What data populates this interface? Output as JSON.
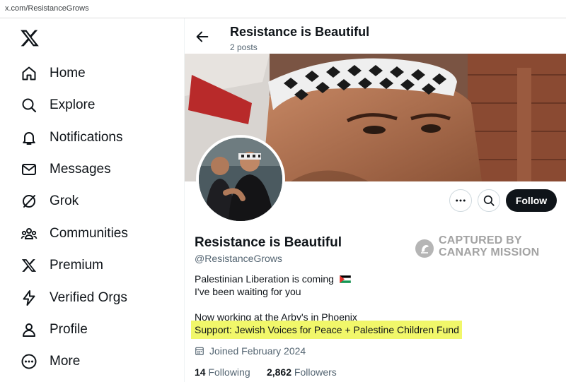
{
  "browser": {
    "url": "x.com/ResistanceGrows"
  },
  "sidebar": {
    "items": [
      {
        "label": "Home",
        "icon": "home-icon"
      },
      {
        "label": "Explore",
        "icon": "search-icon"
      },
      {
        "label": "Notifications",
        "icon": "bell-icon"
      },
      {
        "label": "Messages",
        "icon": "mail-icon"
      },
      {
        "label": "Grok",
        "icon": "grok-icon"
      },
      {
        "label": "Communities",
        "icon": "communities-icon"
      },
      {
        "label": "Premium",
        "icon": "x-logo-icon"
      },
      {
        "label": "Verified Orgs",
        "icon": "lightning-icon"
      },
      {
        "label": "Profile",
        "icon": "person-icon"
      },
      {
        "label": "More",
        "icon": "more-circle-icon"
      }
    ]
  },
  "header": {
    "title": "Resistance is Beautiful",
    "post_count": "2 posts"
  },
  "profile": {
    "name": "Resistance is Beautiful",
    "handle": "@ResistanceGrows",
    "bio_line1": "Palestinian Liberation is coming",
    "bio_line2": "I've been waiting for you",
    "bio_line3": "Now working at the Arby's in Phoenix",
    "bio_line4": "Support: Jewish Voices for Peace + Palestine Children Fund",
    "joined": "Joined February 2024",
    "following_count": "14",
    "following_label": "Following",
    "followers_count": "2,862",
    "followers_label": "Followers",
    "follow_button": "Follow"
  },
  "watermark": {
    "line1": "CAPTURED BY",
    "line2": "CANARY MISSION"
  },
  "colors": {
    "text": "#0f1419",
    "secondary": "#536471",
    "highlight": "#f1f76a",
    "watermark": "#a3a3a3"
  }
}
